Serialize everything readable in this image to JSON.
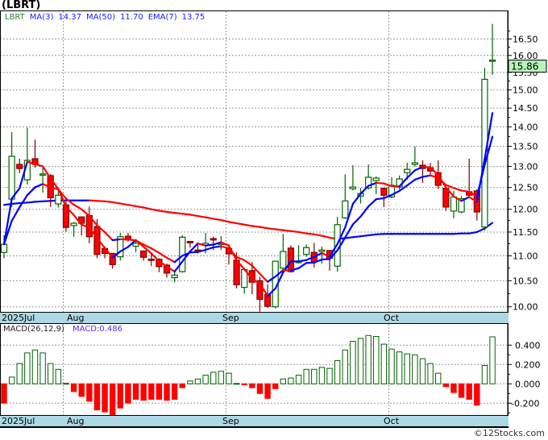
{
  "title": "(LBRT)",
  "legend": {
    "symbol": "LBRT",
    "ma3_label": "MA(3)",
    "ma3_value": "14.37",
    "ma50_label": "MA(50)",
    "ma50_value": "11.70",
    "ema7_label": "EMA(7)",
    "ema7_value": "13.75"
  },
  "last_price_label": "15.86",
  "macd_legend": {
    "label": "MACD(26,12,9)",
    "value": "MACD:0.486"
  },
  "date_labels": [
    "2025Jul",
    "Aug",
    "Sep",
    "Oct"
  ],
  "footer": "©12Stocks.com",
  "colors": {
    "up": "#006400",
    "down_fill": "#ff0000",
    "down_edge": "#800000",
    "line_up": "#0000ff",
    "line_down": "#ff0000",
    "date_bar": "#add8e6",
    "last_price_bg": "#b8f5b8",
    "grid": "#999999"
  },
  "chart_data": [
    {
      "type": "candlestick",
      "scale": "log",
      "ylim": [
        9.9,
        17.0
      ],
      "y_ticks": [
        "10.00",
        "10.50",
        "11.00",
        "11.50",
        "12.00",
        "12.50",
        "13.00",
        "13.50",
        "14.00",
        "14.50",
        "15.00",
        "15.50",
        "16.00",
        "16.50"
      ],
      "x_month_starts": {
        "Aug": 8,
        "Sep": 29,
        "Oct": 50
      },
      "grid": true,
      "ohlc": [
        [
          11.07,
          11.43,
          10.95,
          11.24
        ],
        [
          12.23,
          13.86,
          12.05,
          13.25
        ],
        [
          13.05,
          13.19,
          12.84,
          12.95
        ],
        [
          12.68,
          13.98,
          12.57,
          13.15
        ],
        [
          13.19,
          13.67,
          12.97,
          13.05
        ],
        [
          12.8,
          12.97,
          12.38,
          12.82
        ],
        [
          12.78,
          12.82,
          12.05,
          12.26
        ],
        [
          12.12,
          12.42,
          12.04,
          12.32
        ],
        [
          12.1,
          12.17,
          11.51,
          11.6
        ],
        [
          11.64,
          11.72,
          11.4,
          11.69
        ],
        [
          11.83,
          11.83,
          11.43,
          11.69
        ],
        [
          11.86,
          12.06,
          11.26,
          11.4
        ],
        [
          11.62,
          11.78,
          10.95,
          11.03
        ],
        [
          11.15,
          11.2,
          10.95,
          11.05
        ],
        [
          11.05,
          11.05,
          10.74,
          10.82
        ],
        [
          10.98,
          11.48,
          10.9,
          11.4
        ],
        [
          11.41,
          11.48,
          11.3,
          11.33
        ],
        [
          11.2,
          11.31,
          11.07,
          11.26
        ],
        [
          11.1,
          11.1,
          10.9,
          10.97
        ],
        [
          10.93,
          11.05,
          10.79,
          10.92
        ],
        [
          10.93,
          10.95,
          10.67,
          10.78
        ],
        [
          10.81,
          10.84,
          10.56,
          10.65
        ],
        [
          10.56,
          10.71,
          10.47,
          10.61
        ],
        [
          10.68,
          11.43,
          10.66,
          11.39
        ],
        [
          11.3,
          11.3,
          11.17,
          11.27
        ],
        [
          11.12,
          11.28,
          11.05,
          11.11
        ],
        [
          11.22,
          11.48,
          11.05,
          11.26
        ],
        [
          11.36,
          11.4,
          11.12,
          11.33
        ],
        [
          11.24,
          11.41,
          11.12,
          11.26
        ],
        [
          11.15,
          11.24,
          10.82,
          11.04
        ],
        [
          10.91,
          11.07,
          10.35,
          10.42
        ],
        [
          10.37,
          10.76,
          10.25,
          10.72
        ],
        [
          10.7,
          10.87,
          10.24,
          10.47
        ],
        [
          10.5,
          10.58,
          9.91,
          10.14
        ],
        [
          10.23,
          10.43,
          9.98,
          10.01
        ],
        [
          10.0,
          10.9,
          9.97,
          10.89
        ],
        [
          10.75,
          11.46,
          10.72,
          11.09
        ],
        [
          11.16,
          11.22,
          10.66,
          10.68
        ],
        [
          10.86,
          11.22,
          10.84,
          10.89
        ],
        [
          11.03,
          11.24,
          10.98,
          11.17
        ],
        [
          11.07,
          11.27,
          10.76,
          10.88
        ],
        [
          11.09,
          11.19,
          10.84,
          11.12
        ],
        [
          11.11,
          11.11,
          10.7,
          10.95
        ],
        [
          10.79,
          11.83,
          10.68,
          11.66
        ],
        [
          11.81,
          12.81,
          11.78,
          12.19
        ],
        [
          12.47,
          13.03,
          12.43,
          12.51
        ],
        [
          12.3,
          12.49,
          12.13,
          12.36
        ],
        [
          12.49,
          13.05,
          12.45,
          12.74
        ],
        [
          12.66,
          12.76,
          12.34,
          12.72
        ],
        [
          12.48,
          12.48,
          12.05,
          12.32
        ],
        [
          12.28,
          12.74,
          12.25,
          12.55
        ],
        [
          12.51,
          12.78,
          12.45,
          12.7
        ],
        [
          12.85,
          13.09,
          12.68,
          12.93
        ],
        [
          13.05,
          13.49,
          13.0,
          13.09
        ],
        [
          13.03,
          13.15,
          12.61,
          12.95
        ],
        [
          12.97,
          13.09,
          12.8,
          12.89
        ],
        [
          12.85,
          13.15,
          12.46,
          12.55
        ],
        [
          12.48,
          12.48,
          11.96,
          12.05
        ],
        [
          11.96,
          12.42,
          11.8,
          12.28
        ],
        [
          11.94,
          12.3,
          11.91,
          12.24
        ],
        [
          12.4,
          13.19,
          12.25,
          12.32
        ],
        [
          12.42,
          12.46,
          11.75,
          11.94
        ],
        [
          11.61,
          15.63,
          11.53,
          15.3
        ],
        [
          15.83,
          16.97,
          15.43,
          15.86
        ]
      ],
      "ma50": [
        12.1,
        12.12,
        12.14,
        12.15,
        12.17,
        12.18,
        12.19,
        12.2,
        12.2,
        12.2,
        12.2,
        12.2,
        12.19,
        12.18,
        12.16,
        12.13,
        12.1,
        12.07,
        12.04,
        12.0,
        11.97,
        11.94,
        11.92,
        11.9,
        11.88,
        11.85,
        11.82,
        11.79,
        11.76,
        11.72,
        11.69,
        11.66,
        11.63,
        11.61,
        11.58,
        11.56,
        11.54,
        11.52,
        11.5,
        11.47,
        11.45,
        11.42,
        11.38,
        11.35,
        11.37,
        11.39,
        11.41,
        11.43,
        11.45,
        11.46,
        11.46,
        11.46,
        11.46,
        11.46,
        11.46,
        11.46,
        11.46,
        11.46,
        11.46,
        11.47,
        11.47,
        11.5,
        11.58,
        11.7
      ]
    },
    {
      "type": "bar",
      "name": "MACD(26,12,9)",
      "ylim": [
        -0.35,
        0.55
      ],
      "y_ticks": [
        "0.400",
        "0.200",
        "0.000",
        "-0.200"
      ],
      "grid": true,
      "values": [
        -0.2,
        0.07,
        0.21,
        0.32,
        0.35,
        0.32,
        0.21,
        0.15,
        0.005,
        -0.08,
        -0.13,
        -0.18,
        -0.27,
        -0.29,
        -0.32,
        -0.25,
        -0.2,
        -0.16,
        -0.17,
        -0.16,
        -0.16,
        -0.17,
        -0.16,
        -0.04,
        0.03,
        0.05,
        0.09,
        0.12,
        0.13,
        0.11,
        0.004,
        -0.01,
        -0.04,
        -0.1,
        -0.15,
        -0.05,
        0.05,
        0.06,
        0.09,
        0.15,
        0.15,
        0.17,
        0.16,
        0.24,
        0.35,
        0.44,
        0.47,
        0.5,
        0.49,
        0.41,
        0.36,
        0.33,
        0.31,
        0.3,
        0.26,
        0.21,
        0.11,
        -0.03,
        -0.09,
        -0.14,
        -0.16,
        -0.22,
        0.19,
        0.486
      ]
    }
  ]
}
